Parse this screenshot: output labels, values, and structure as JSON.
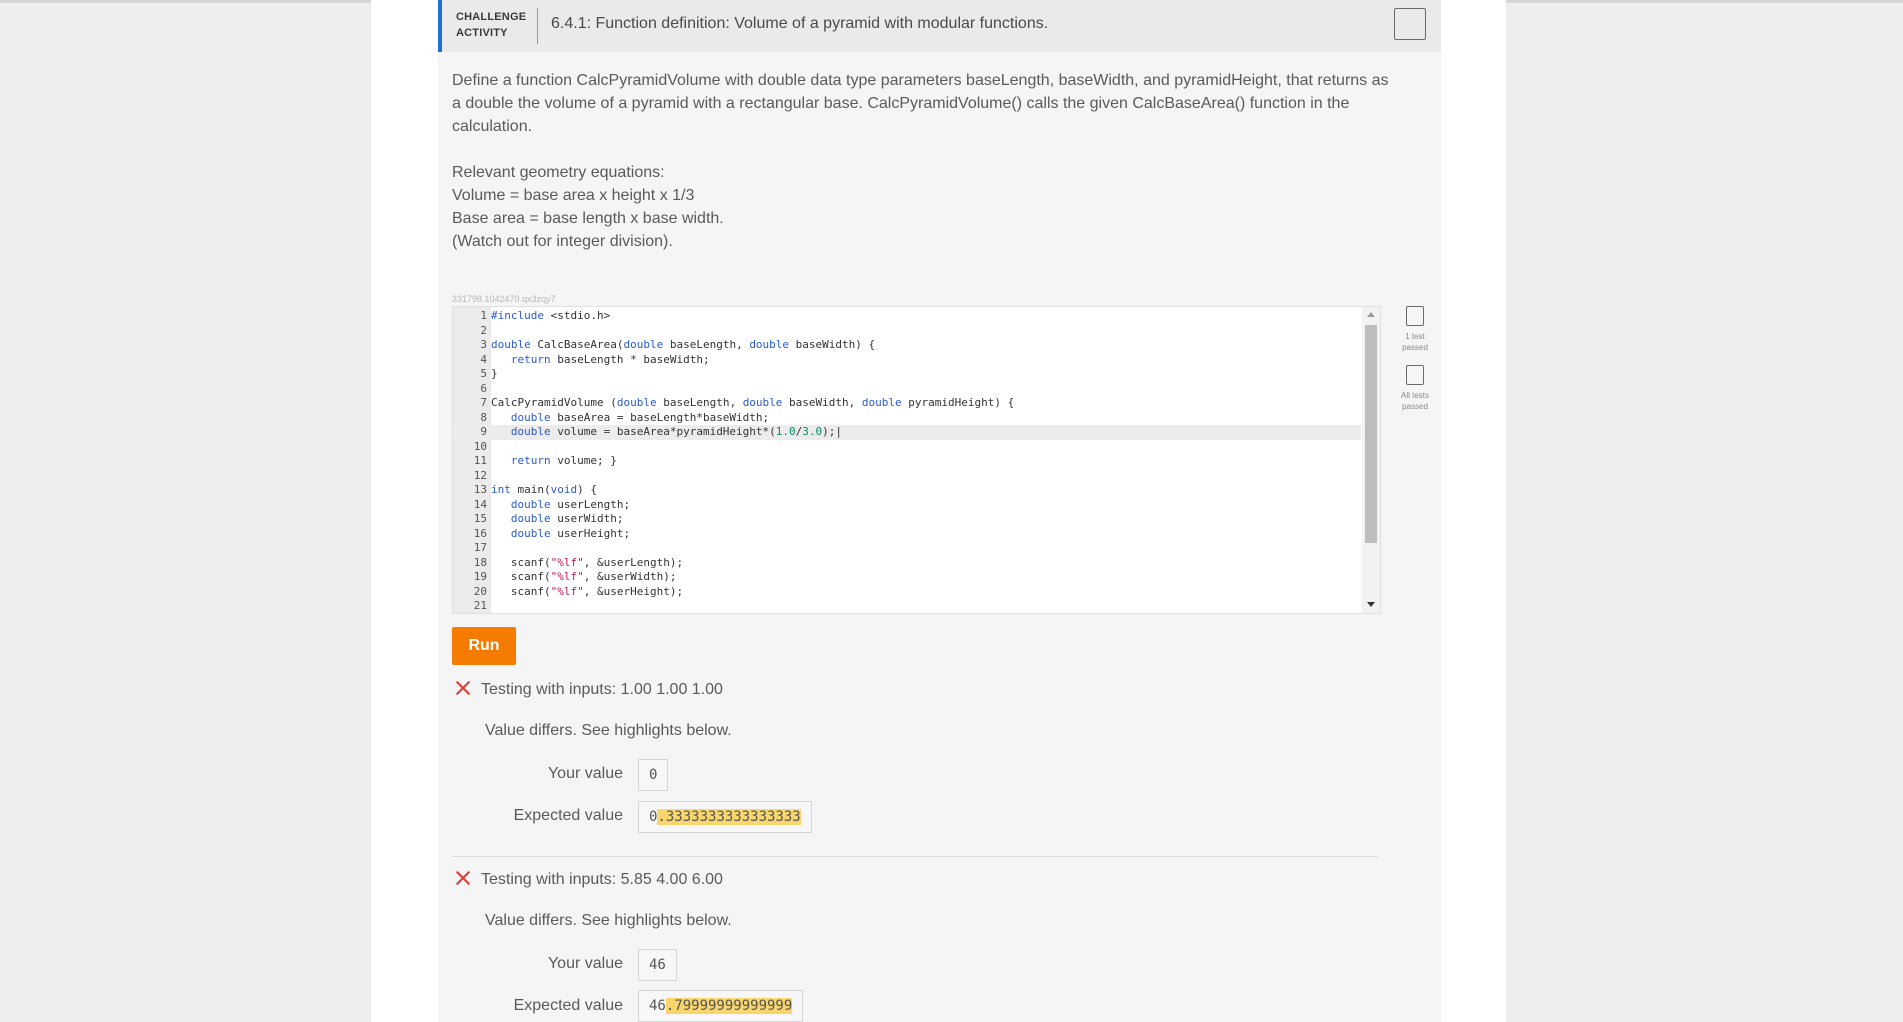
{
  "header": {
    "activity_label_line1": "CHALLENGE",
    "activity_label_line2": "ACTIVITY",
    "title": "6.4.1: Function definition: Volume of a pyramid with modular functions."
  },
  "prompt": {
    "paragraph": "Define a function CalcPyramidVolume with double data type parameters baseLength, baseWidth, and pyramidHeight, that returns as a double the volume of a pyramid with a rectangular base. CalcPyramidVolume() calls the given CalcBaseArea() function in the calculation.",
    "equations_heading": "Relevant geometry equations:",
    "equation_volume": "Volume = base area x height x 1/3",
    "equation_area": "Base area = base length x base width.",
    "note": "(Watch out for integer division)."
  },
  "code_id": "331798.1042470.qx3zqy7",
  "code_lines": [
    "1",
    "2",
    "3",
    "4",
    "5",
    "6",
    "7",
    "8",
    "9",
    "10",
    "11",
    "12",
    "13",
    "14",
    "15",
    "16",
    "17",
    "18",
    "19",
    "20",
    "21"
  ],
  "test_status": {
    "one_test_line1": "1 test",
    "one_test_line2": "passed",
    "all_tests_line1": "All tests",
    "all_tests_line2": "passed"
  },
  "run_label": "Run",
  "tests": [
    {
      "heading": "Testing with inputs: 1.00 1.00 1.00",
      "message": "Value differs. See highlights below.",
      "your_label": "Your value",
      "your_value": "0",
      "expected_label": "Expected value",
      "expected_prefix": "0",
      "expected_highlight": ".3333333333333333"
    },
    {
      "heading": "Testing with inputs: 5.85 4.00 6.00",
      "message": "Value differs. See highlights below.",
      "your_label": "Your value",
      "your_value": "46",
      "expected_label": "Expected value",
      "expected_prefix": "46",
      "expected_highlight": ".79999999999999"
    }
  ],
  "colors": {
    "accent_blue": "#1f6fd6",
    "run_orange": "#f57c00",
    "fail_red": "#e53935",
    "highlight": "#f8d66d"
  }
}
